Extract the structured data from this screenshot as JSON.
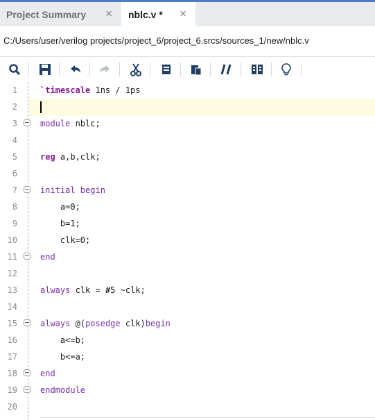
{
  "tabs": [
    {
      "label": "Project Summary",
      "close": "×"
    },
    {
      "label": "nblc.v *",
      "close": "×"
    }
  ],
  "path": "C:/Users/user/verilog projects/project_6/project_6.srcs/sources_1/new/nblc.v",
  "toolbar": {
    "icons": [
      "search-icon",
      "save-icon",
      "undo-icon",
      "redo-icon",
      "cut-icon",
      "copy-icon",
      "paste-icon",
      "comment-icon",
      "insert-template-icon",
      "lightbulb-icon"
    ]
  },
  "code": {
    "line_numbers": [
      "1",
      "2",
      "3",
      "4",
      "5",
      "6",
      "7",
      "8",
      "9",
      "10",
      "11",
      "12",
      "13",
      "14",
      "15",
      "16",
      "17",
      "18",
      "19",
      "20"
    ],
    "l1_kw": "`timescale",
    "l1_rest": " 1ns / 1ps",
    "l3_kw": "module",
    "l3_rest": " nblc;",
    "l5_kw": "reg",
    "l5_rest": " a,b,clk;",
    "l7_kw": "initial begin",
    "l8": "    a=0;",
    "l9": "    b=1;",
    "l10": "    clk=0;",
    "l11_kw": "end",
    "l13_kw": "always",
    "l13_rest": " clk = ",
    "l13_num": "#5",
    "l13_tail": " ~clk;",
    "l15_kw": "always",
    "l15_rest": " ",
    "l15_at": "@",
    "l15_paren": "(",
    "l15_pos": "posedge",
    "l15_tail": " clk)",
    "l15_begin": "begin",
    "l16": "    a<=b;",
    "l17": "    b<=a;",
    "l18_kw": "end",
    "l19_kw": "endmodule"
  },
  "colors": {
    "accent": "#4b7cc3",
    "keyword": "#7b2fb0",
    "current_line": "#fffbe0"
  }
}
